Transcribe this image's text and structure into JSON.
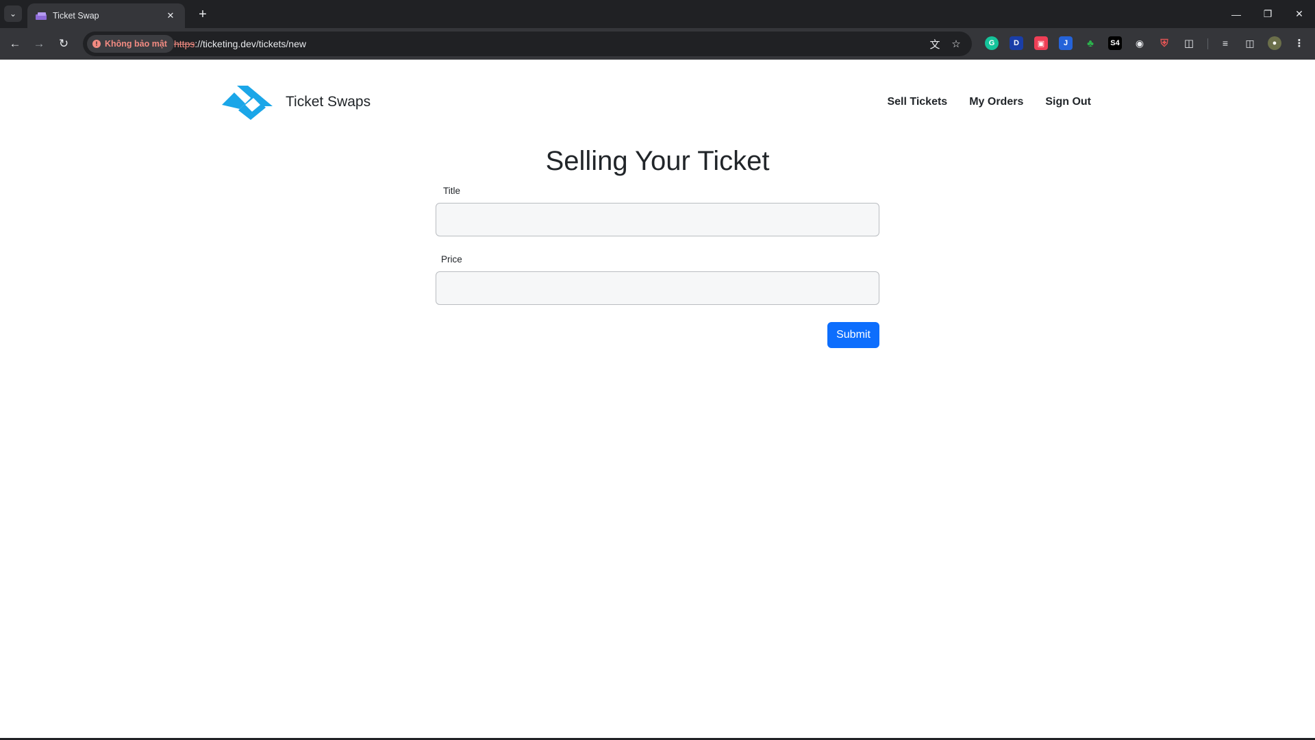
{
  "browser": {
    "tab_title": "Ticket Swap",
    "security_label": "Không bảo mật",
    "url_scheme": "https",
    "url_rest": "://ticketing.dev/tickets/new",
    "icons": {
      "tab_list": "chevron-down-icon",
      "new_tab": "plus-icon",
      "back": "arrow-left-icon",
      "forward": "arrow-right-icon",
      "reload": "reload-icon",
      "translate": "translate-icon",
      "bookmark": "star-icon"
    },
    "extensions": [
      "grammarly",
      "dashlane",
      "pocket",
      "jira",
      "clover",
      "s4",
      "eye",
      "shield",
      "puzzle",
      "media-controls",
      "side-panel",
      "profile",
      "menu"
    ],
    "accent": "#f28b82"
  },
  "header": {
    "brand": "Ticket Swaps",
    "nav": [
      "Sell Tickets",
      "My Orders",
      "Sign Out"
    ]
  },
  "form": {
    "heading": "Selling Your Ticket",
    "title_label": "Title",
    "title_value": "",
    "price_label": "Price",
    "price_value": "",
    "submit_label": "Submit"
  },
  "colors": {
    "logo": "#1ba6e8",
    "primary_button": "#0d6efd"
  }
}
